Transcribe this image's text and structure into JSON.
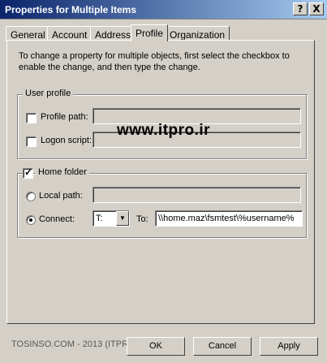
{
  "window": {
    "title": "Properties for Multiple Items",
    "help_label": "?",
    "close_label": "X"
  },
  "tabs": [
    {
      "label": "General"
    },
    {
      "label": "Account"
    },
    {
      "label": "Address"
    },
    {
      "label": "Profile",
      "active": true
    },
    {
      "label": "Organization"
    }
  ],
  "intro_text": "To change a property for multiple objects, first select the checkbox to enable the change, and then type the change.",
  "user_profile": {
    "title": "User profile",
    "profile_path": {
      "label": "Profile path:",
      "checked": false,
      "value": ""
    },
    "logon_script": {
      "label": "Logon script:",
      "checked": false,
      "value": ""
    }
  },
  "watermark": "www.itpro.ir",
  "home_folder": {
    "title": "Home folder",
    "checked": true,
    "local_path": {
      "label": "Local path:",
      "selected": false,
      "value": ""
    },
    "connect": {
      "label": "Connect:",
      "selected": true,
      "drive": "T:",
      "to_label": "To:",
      "to_value": "\\\\home.maz\\fsmtest\\%username%"
    }
  },
  "footer_watermark": "TOSINSO.COM - 2013 (ITPRO.ir)",
  "buttons": {
    "ok": "OK",
    "cancel": "Cancel",
    "apply": "Apply"
  }
}
